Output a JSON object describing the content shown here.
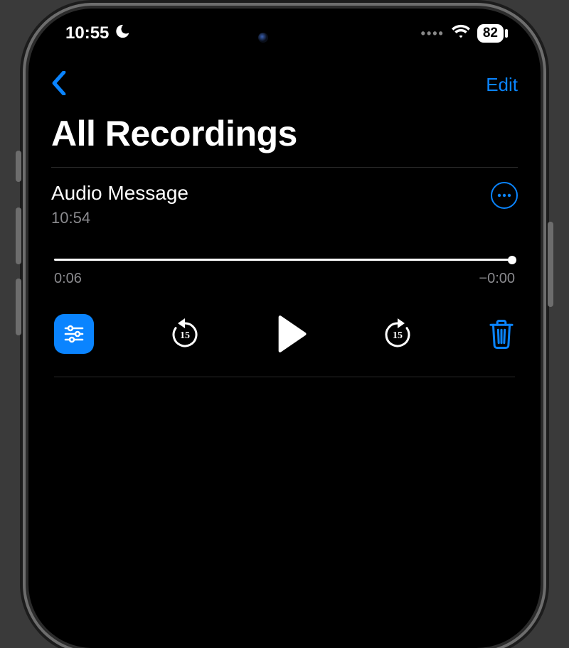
{
  "status": {
    "time": "10:55",
    "battery": "82"
  },
  "nav": {
    "edit": "Edit"
  },
  "title": "All Recordings",
  "recording": {
    "name": "Audio Message",
    "created": "10:54"
  },
  "playback": {
    "elapsed": "0:06",
    "remaining": "−0:00",
    "skip_seconds": "15"
  }
}
